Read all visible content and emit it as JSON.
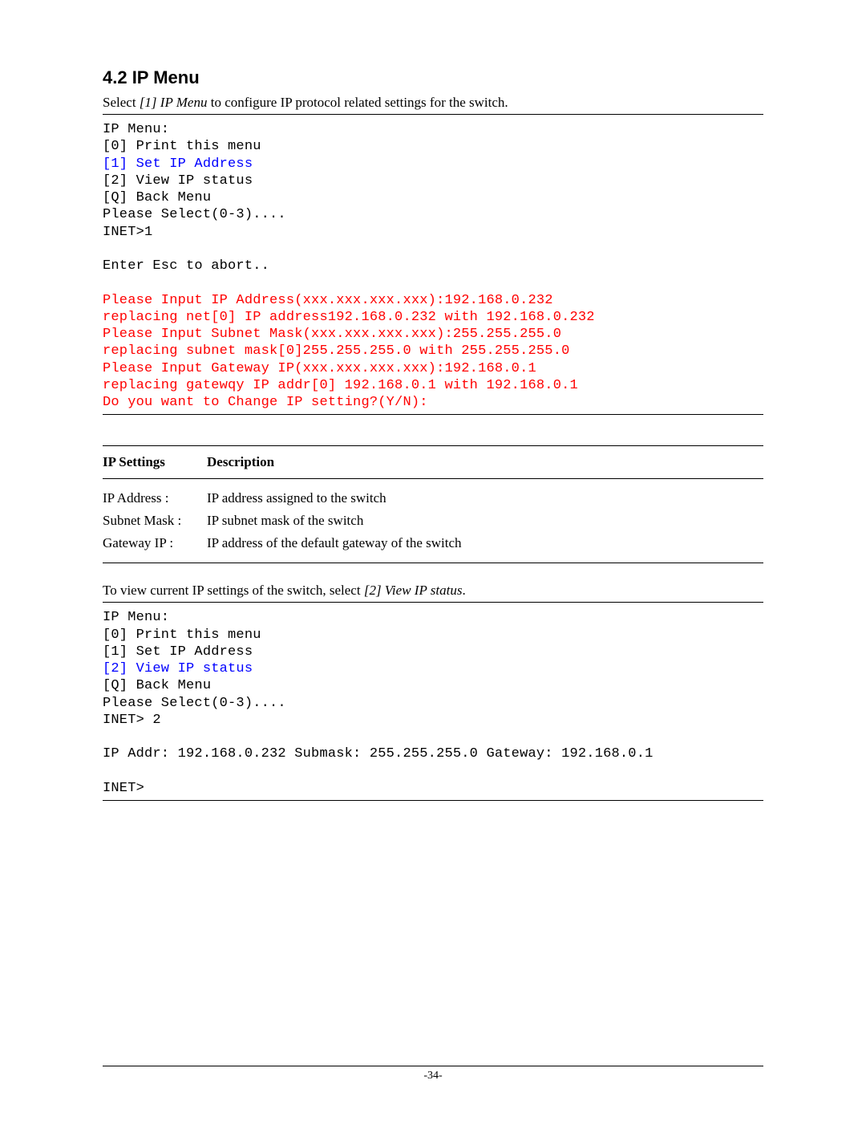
{
  "section": {
    "number": "4.2",
    "title": "IP Menu",
    "heading": "4.2 IP Menu"
  },
  "intro": {
    "prefix": "Select ",
    "emph": "[1] IP Menu",
    "suffix": " to configure IP protocol related settings for the switch."
  },
  "terminal1": {
    "line1": "IP Menu:",
    "line2": "[0] Print this menu",
    "line3_blue": "[1] Set IP Address",
    "line4": "[2] View IP status",
    "line5": "[Q] Back Menu",
    "line6": "Please Select(0-3)....",
    "line7": "INET>1",
    "blank1": "",
    "line8": "Enter Esc to abort..",
    "blank2": "",
    "red1": "Please Input IP Address(xxx.xxx.xxx.xxx):192.168.0.232",
    "red2": "replacing net[0] IP address192.168.0.232 with 192.168.0.232",
    "red3": "Please Input Subnet Mask(xxx.xxx.xxx.xxx):255.255.255.0",
    "red4": "replacing subnet mask[0]255.255.255.0 with 255.255.255.0",
    "red5": "Please Input Gateway IP(xxx.xxx.xxx.xxx):192.168.0.1",
    "red6": "replacing gatewqy IP addr[0] 192.168.0.1 with 192.168.0.1",
    "red7": "Do you want to Change IP setting?(Y/N):"
  },
  "settings": {
    "headers": {
      "c1": "IP Settings",
      "c2": "Description"
    },
    "rows": [
      {
        "key": "IP Address :",
        "desc": "IP address assigned to the switch"
      },
      {
        "key": "Subnet Mask :",
        "desc": "IP subnet mask of the switch"
      },
      {
        "key": "Gateway IP :",
        "desc": "IP address of the default gateway of the switch"
      }
    ]
  },
  "para2": {
    "prefix": "To view current IP settings of the switch, select ",
    "emph": "[2] View IP status",
    "suffix": "."
  },
  "terminal2": {
    "line1": "IP Menu:",
    "line2": "[0] Print this menu",
    "line3": "[1] Set IP Address",
    "line4_blue": "[2] View IP status",
    "line5": "[Q] Back Menu",
    "line6": "Please Select(0-3)....",
    "line7": "INET> 2",
    "blank1": "",
    "line8": "IP Addr: 192.168.0.232 Submask: 255.255.255.0 Gateway: 192.168.0.1",
    "blank2": "",
    "line9": "INET>"
  },
  "footer": {
    "page": "-34-"
  }
}
